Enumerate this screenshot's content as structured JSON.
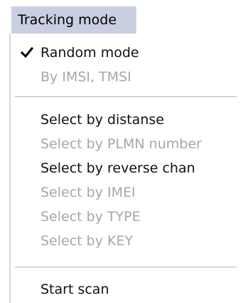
{
  "menu": {
    "title": "Tracking mode",
    "items": [
      {
        "label": "Random mode",
        "checked": true,
        "enabled": true
      },
      {
        "label": "By IMSI, TMSI",
        "checked": false,
        "enabled": false
      },
      {
        "label": "Select by distanse",
        "checked": false,
        "enabled": true
      },
      {
        "label": "Select by PLMN number",
        "checked": false,
        "enabled": false
      },
      {
        "label": "Select by reverse chan",
        "checked": false,
        "enabled": true
      },
      {
        "label": "Select by IMEI",
        "checked": false,
        "enabled": false
      },
      {
        "label": "Select by TYPE",
        "checked": false,
        "enabled": false
      },
      {
        "label": "Select by KEY",
        "checked": false,
        "enabled": false
      },
      {
        "label": "Start scan",
        "checked": false,
        "enabled": true
      }
    ]
  },
  "colors": {
    "menu_title_background": "#c9cfe0",
    "enabled_text": "#111111",
    "disabled_text": "#a7a7a7"
  }
}
